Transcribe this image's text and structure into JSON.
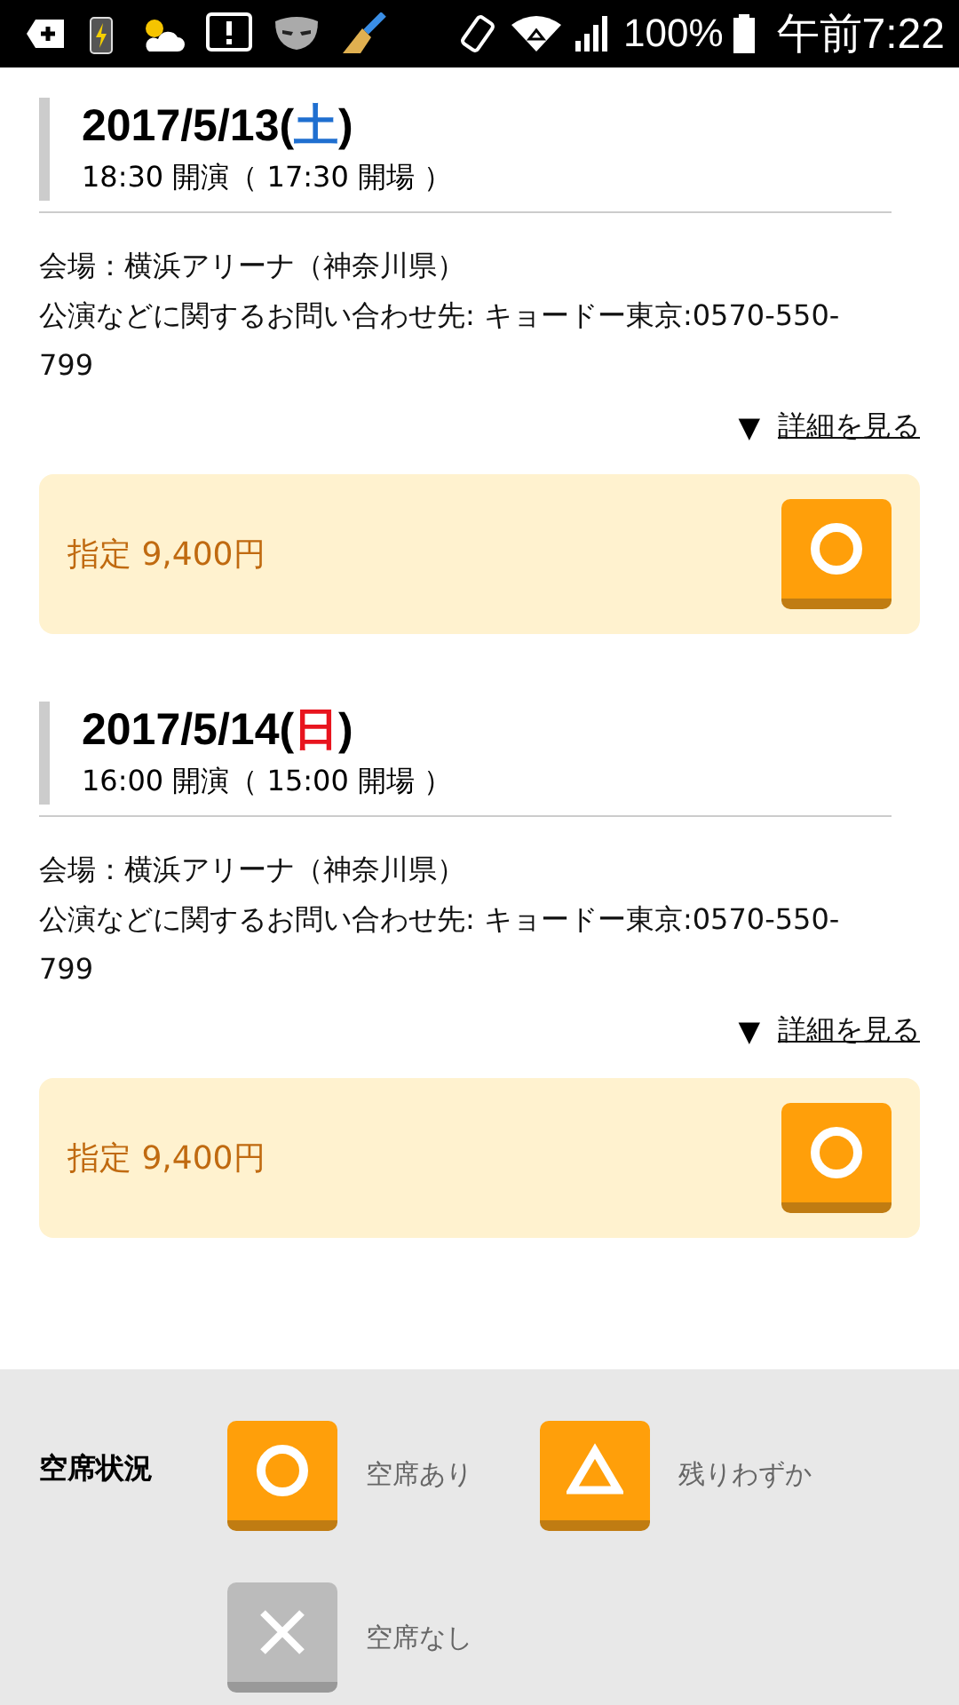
{
  "status_bar": {
    "battery": "100%",
    "time": "午前7:22"
  },
  "events": [
    {
      "date": "2017/5/13",
      "day": {
        "open": "(",
        "text": "土",
        "close": ")",
        "color": "#1f6fd0"
      },
      "times": "18:30 開演（ 17:30 開場 ）",
      "venue": "会場：横浜アリーナ（神奈川県）",
      "contact": "公演などに関するお問い合わせ先: キョードー東京:0570-550-799",
      "details_link": "詳細を見る",
      "expand_icon": "▼",
      "tickets": [
        {
          "label": "指定 9,400円",
          "kind": "available"
        }
      ]
    },
    {
      "date": "2017/5/14",
      "day": {
        "open": "(",
        "text": "日",
        "close": ")",
        "color": "#e8141e"
      },
      "times": "16:00 開演（ 15:00 開場 ）",
      "venue": "会場：横浜アリーナ（神奈川県）",
      "contact": "公演などに関するお問い合わせ先: キョードー東京:0570-550-799",
      "details_link": "詳細を見る",
      "expand_icon": "▼",
      "tickets": [
        {
          "label": "指定 9,400円",
          "kind": "available"
        }
      ]
    }
  ],
  "legend": {
    "title": "空席状況",
    "items": [
      {
        "kind": "available",
        "label": "空席あり"
      },
      {
        "kind": "few",
        "label": "残りわずか"
      },
      {
        "kind": "none",
        "label": "空席なし"
      }
    ]
  }
}
